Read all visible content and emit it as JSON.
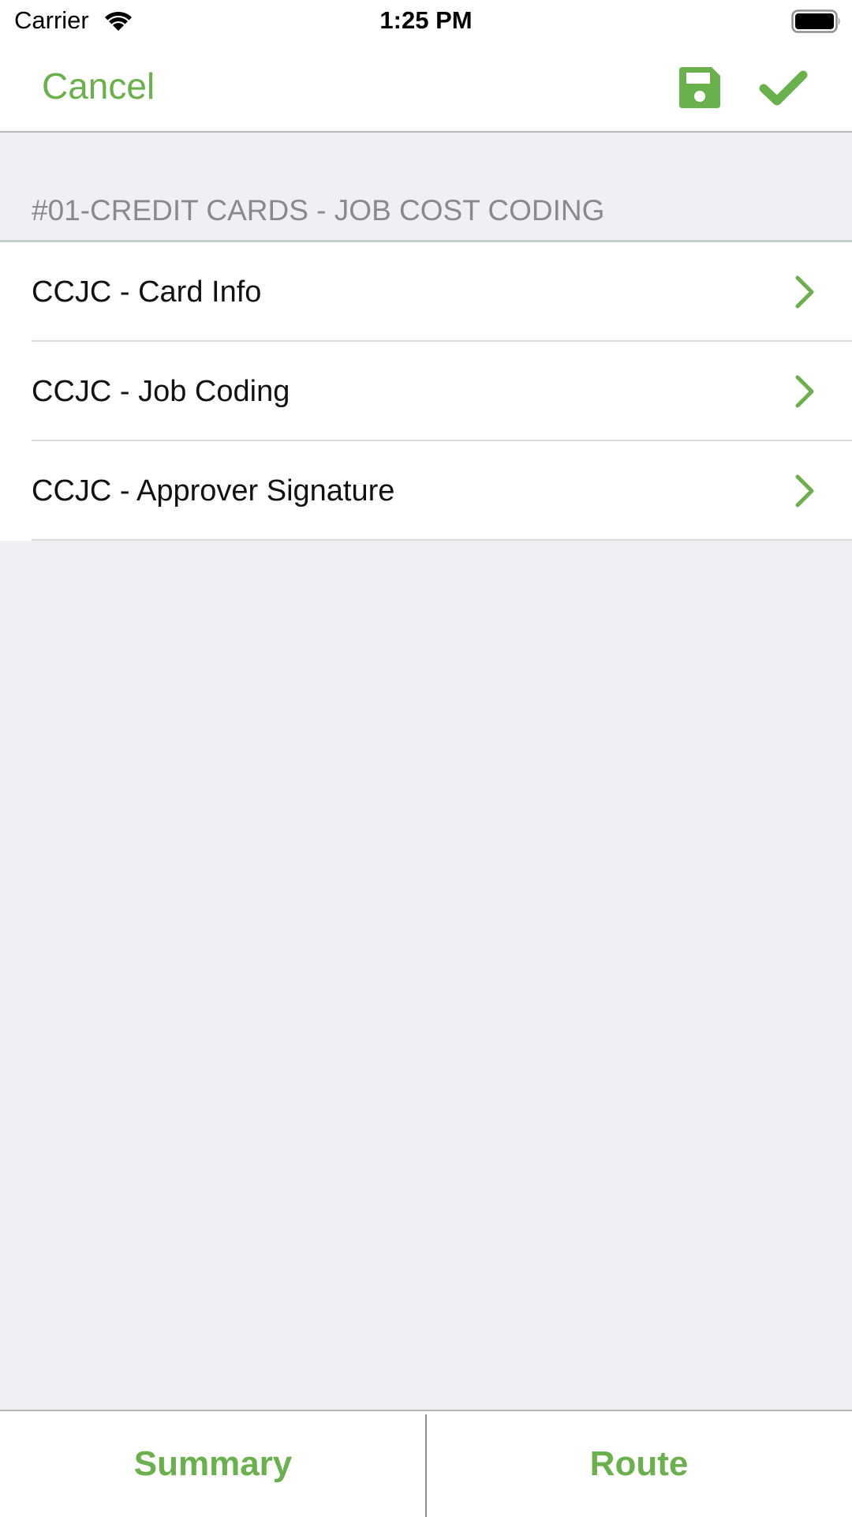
{
  "status_bar": {
    "carrier": "Carrier",
    "time": "1:25 PM",
    "wifi_icon": "wifi-icon",
    "battery_icon": "battery-full-icon"
  },
  "navbar": {
    "cancel_label": "Cancel",
    "save_icon": "save-icon",
    "done_icon": "checkmark-icon"
  },
  "section": {
    "title": "#01-CREDIT CARDS - JOB COST CODING",
    "items": [
      {
        "label": "CCJC - Card Info",
        "icon": "chevron-right-icon"
      },
      {
        "label": "CCJC - Job Coding",
        "icon": "chevron-right-icon"
      },
      {
        "label": "CCJC - Approver Signature",
        "icon": "chevron-right-icon"
      }
    ]
  },
  "tabbar": {
    "tabs": [
      {
        "label": "Summary"
      },
      {
        "label": "Route"
      }
    ]
  },
  "colors": {
    "accent": "#6ab04c",
    "background": "#efeff4",
    "section_title": "#8a8a8e"
  }
}
